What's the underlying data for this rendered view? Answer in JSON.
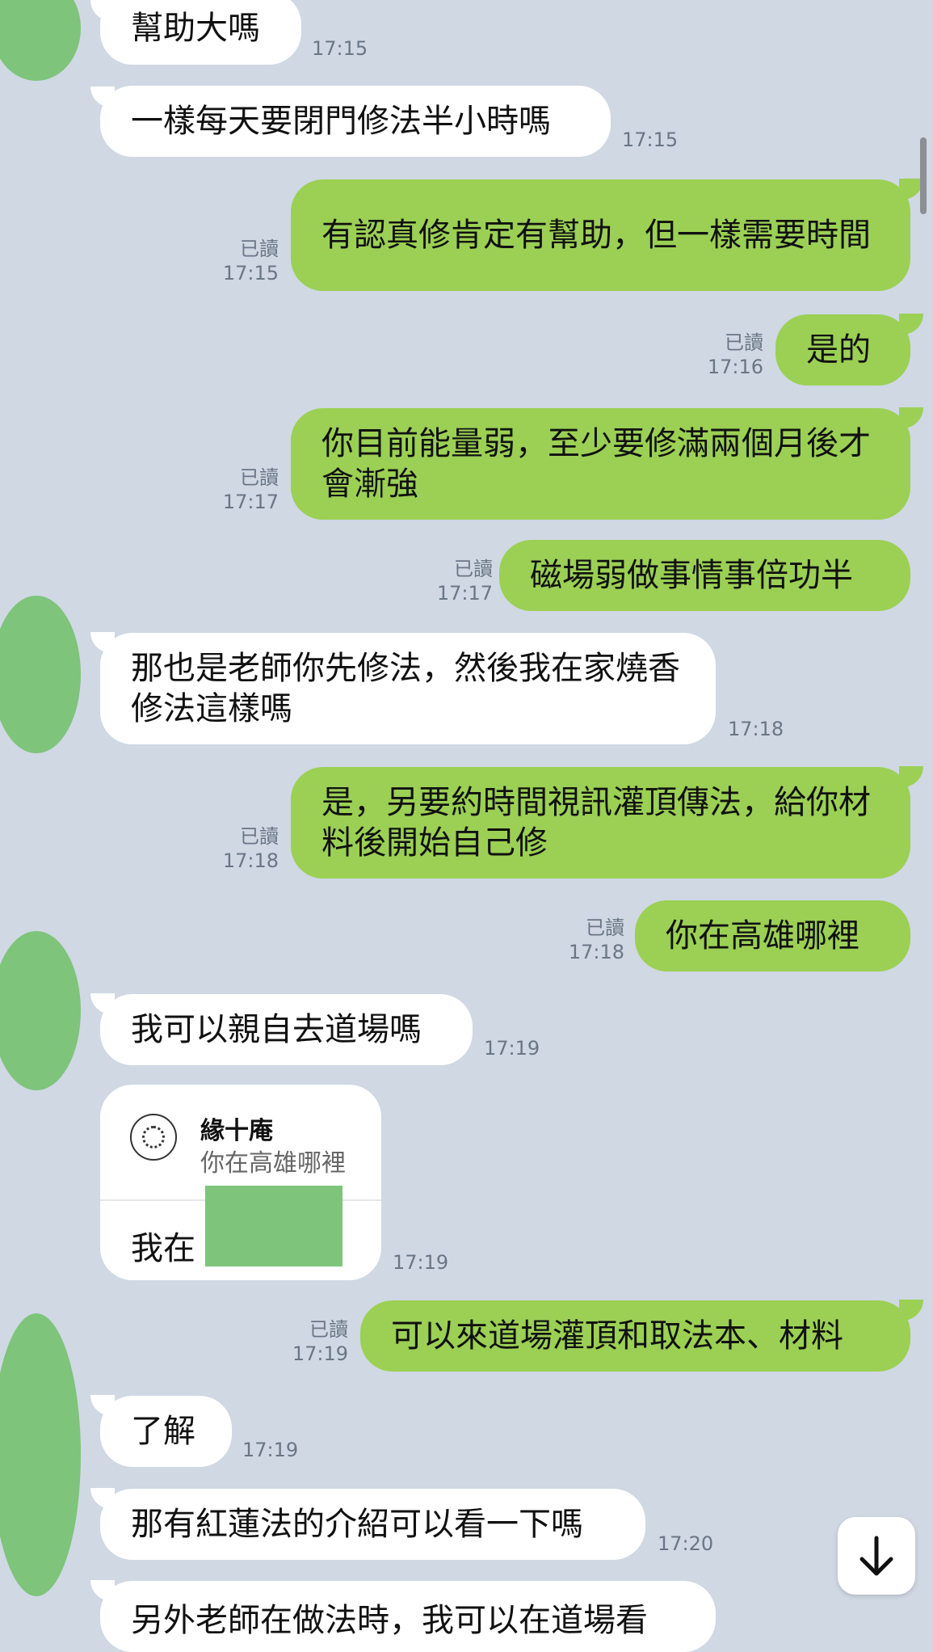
{
  "messages": [
    {
      "dir": "in",
      "text": "幫助大嗎",
      "time": "17:15"
    },
    {
      "dir": "in",
      "text": "一樣每天要閉門修法半小時嗎",
      "time": "17:15"
    },
    {
      "dir": "out",
      "text": "有認真修肯定有幫助，但一樣需要時間",
      "read": "已讀",
      "time": "17:15"
    },
    {
      "dir": "out",
      "text": "是的",
      "read": "已讀",
      "time": "17:16"
    },
    {
      "dir": "out",
      "text": "你目前能量弱，至少要修滿兩個月後才會漸強",
      "read": "已讀",
      "time": "17:17"
    },
    {
      "dir": "out",
      "text": "磁場弱做事情事倍功半",
      "read": "已讀",
      "time": "17:17"
    },
    {
      "dir": "in",
      "text": "那也是老師你先修法，然後我在家燒香修法這樣嗎",
      "time": "17:18"
    },
    {
      "dir": "out",
      "text": "是，另要約時間視訊灌頂傳法，給你材料後開始自己修",
      "read": "已讀",
      "time": "17:18"
    },
    {
      "dir": "out",
      "text": "你在高雄哪裡",
      "read": "已讀",
      "time": "17:18"
    },
    {
      "dir": "in",
      "text": "我可以親自去道場嗎",
      "time": "17:19"
    },
    {
      "dir": "out",
      "text": "可以來道場灌頂和取法本、材料",
      "read": "已讀",
      "time": "17:19"
    },
    {
      "dir": "in",
      "text": "了解",
      "time": "17:19"
    },
    {
      "dir": "in",
      "text": "那有紅蓮法的介紹可以看一下嗎",
      "time": "17:20"
    },
    {
      "dir": "in",
      "text": "另外老師在做法時，我可以在道場看",
      "time": ""
    }
  ],
  "reply": {
    "name": "緣十庵",
    "quote": "你在高雄哪裡",
    "body": "我在",
    "time": "17:19"
  },
  "icons": {
    "scroll_down": "arrow-down-icon",
    "seal": "seal-logo-icon"
  },
  "colors": {
    "background": "#cfd8e3",
    "outgoing": "#9bd054",
    "incoming": "#ffffff",
    "avatar": "#7ec47b"
  }
}
